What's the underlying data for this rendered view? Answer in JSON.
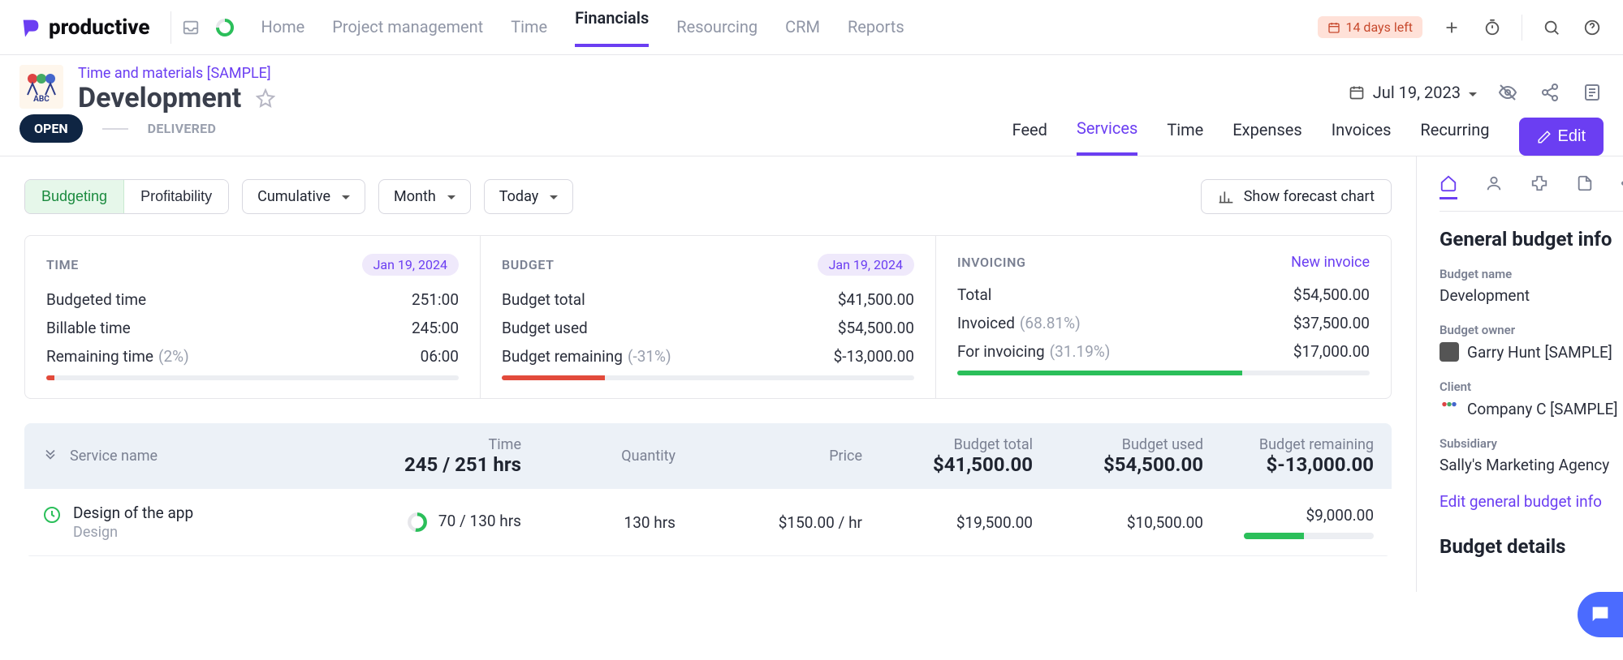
{
  "brand": {
    "name": "productive"
  },
  "nav": {
    "items": [
      "Home",
      "Project management",
      "Time",
      "Financials",
      "Resourcing",
      "CRM",
      "Reports"
    ],
    "active_index": 3
  },
  "trial": {
    "text": "14 days left"
  },
  "project": {
    "breadcrumb": "Time and materials [SAMPLE]",
    "title": "Development",
    "thumb": "ABC"
  },
  "date_selector": "Jul 19, 2023",
  "stages": {
    "open": "OPEN",
    "delivered": "DELIVERED"
  },
  "sub_tabs": {
    "items": [
      "Feed",
      "Services",
      "Time",
      "Expenses",
      "Invoices",
      "Recurring"
    ],
    "active_index": 1,
    "edit": "Edit"
  },
  "toolbar": {
    "segments": [
      "Budgeting",
      "Profitability"
    ],
    "active_segment": 0,
    "dropdowns": {
      "mode": "Cumulative",
      "period": "Month",
      "range": "Today"
    },
    "forecast": "Show forecast chart"
  },
  "cards": {
    "time": {
      "title": "TIME",
      "end_date": "Jan 19, 2024",
      "rows": [
        {
          "label": "Budgeted time",
          "value": "251:00"
        },
        {
          "label": "Billable time",
          "value": "245:00"
        },
        {
          "label": "Remaining time",
          "pct": "(2%)",
          "value": "06:00"
        }
      ],
      "progress_pct": 2,
      "progress_color": "red"
    },
    "budget": {
      "title": "BUDGET",
      "end_date": "Jan 19, 2024",
      "rows": [
        {
          "label": "Budget total",
          "value": "$41,500.00"
        },
        {
          "label": "Budget used",
          "value": "$54,500.00"
        },
        {
          "label": "Budget remaining",
          "pct": "(-31%)",
          "value": "$-13,000.00"
        }
      ],
      "progress_pct": 25,
      "progress_color": "red"
    },
    "invoicing": {
      "title": "INVOICING",
      "link": "New invoice",
      "rows": [
        {
          "label": "Total",
          "value": "$54,500.00"
        },
        {
          "label": "Invoiced",
          "pct": "(68.81%)",
          "value": "$37,500.00"
        },
        {
          "label": "For invoicing",
          "pct": "(31.19%)",
          "value": "$17,000.00"
        }
      ],
      "progress_pct": 69,
      "progress_color": "green"
    }
  },
  "table": {
    "headers": {
      "service": "Service name",
      "time": "Time",
      "time_total": "245 / 251 hrs",
      "quantity": "Quantity",
      "price": "Price",
      "budget_total_label": "Budget total",
      "budget_total": "$41,500.00",
      "budget_used_label": "Budget used",
      "budget_used": "$54,500.00",
      "budget_remaining_label": "Budget remaining",
      "budget_remaining": "$-13,000.00"
    },
    "rows": [
      {
        "name": "Design of the app",
        "sub": "Design",
        "time": "70 / 130 hrs",
        "quantity": "130 hrs",
        "price": "$150.00 / hr",
        "budget_total": "$19,500.00",
        "budget_used": "$10,500.00",
        "budget_remaining": "$9,000.00",
        "remaining_pct": 46
      }
    ]
  },
  "sidebar": {
    "section_title": "General budget info",
    "budget_name_label": "Budget name",
    "budget_name": "Development",
    "owner_label": "Budget owner",
    "owner": "Garry Hunt [SAMPLE]",
    "client_label": "Client",
    "client": "Company C [SAMPLE]",
    "subsidiary_label": "Subsidiary",
    "subsidiary": "Sally's Marketing Agency",
    "edit_link": "Edit general budget info",
    "details_title": "Budget details"
  }
}
